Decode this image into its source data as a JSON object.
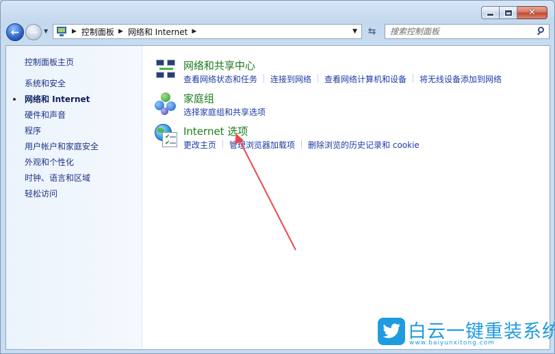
{
  "window": {
    "caption_buttons": {
      "minimize_icon": "minimize-icon",
      "maximize_icon": "maximize-icon",
      "close_icon": "close-icon"
    }
  },
  "navbar": {
    "breadcrumbs": [
      "控制面板",
      "网络和 Internet"
    ],
    "search_placeholder": "搜索控制面板"
  },
  "sidebar": {
    "home_label": "控制面板主页",
    "items": [
      {
        "label": "系统和安全",
        "active": false
      },
      {
        "label": "网络和 Internet",
        "active": true
      },
      {
        "label": "硬件和声音",
        "active": false
      },
      {
        "label": "程序",
        "active": false
      },
      {
        "label": "用户帐户和家庭安全",
        "active": false
      },
      {
        "label": "外观和个性化",
        "active": false
      },
      {
        "label": "时钟、语言和区域",
        "active": false
      },
      {
        "label": "轻松访问",
        "active": false
      }
    ]
  },
  "categories": [
    {
      "title": "网络和共享中心",
      "icon": "network-sharing-icon",
      "links": [
        "查看网络状态和任务",
        "连接到网络",
        "查看网络计算机和设备",
        "将无线设备添加到网络"
      ]
    },
    {
      "title": "家庭组",
      "icon": "homegroup-icon",
      "links": [
        "选择家庭组和共享选项"
      ]
    },
    {
      "title": "Internet 选项",
      "icon": "internet-options-icon",
      "links": [
        "更改主页",
        "管理浏览器加载项",
        "删除浏览的历史记录和 cookie"
      ]
    }
  ],
  "watermark": {
    "text": "白云一键重装系统",
    "url": "www.baiyunxitong.com"
  },
  "colors": {
    "category_title": "#1a7a1a",
    "link": "#1c3aa8",
    "sidebar_text": "#1e3287",
    "annotation": "#e8464a",
    "watermark": "#1f9be0"
  }
}
